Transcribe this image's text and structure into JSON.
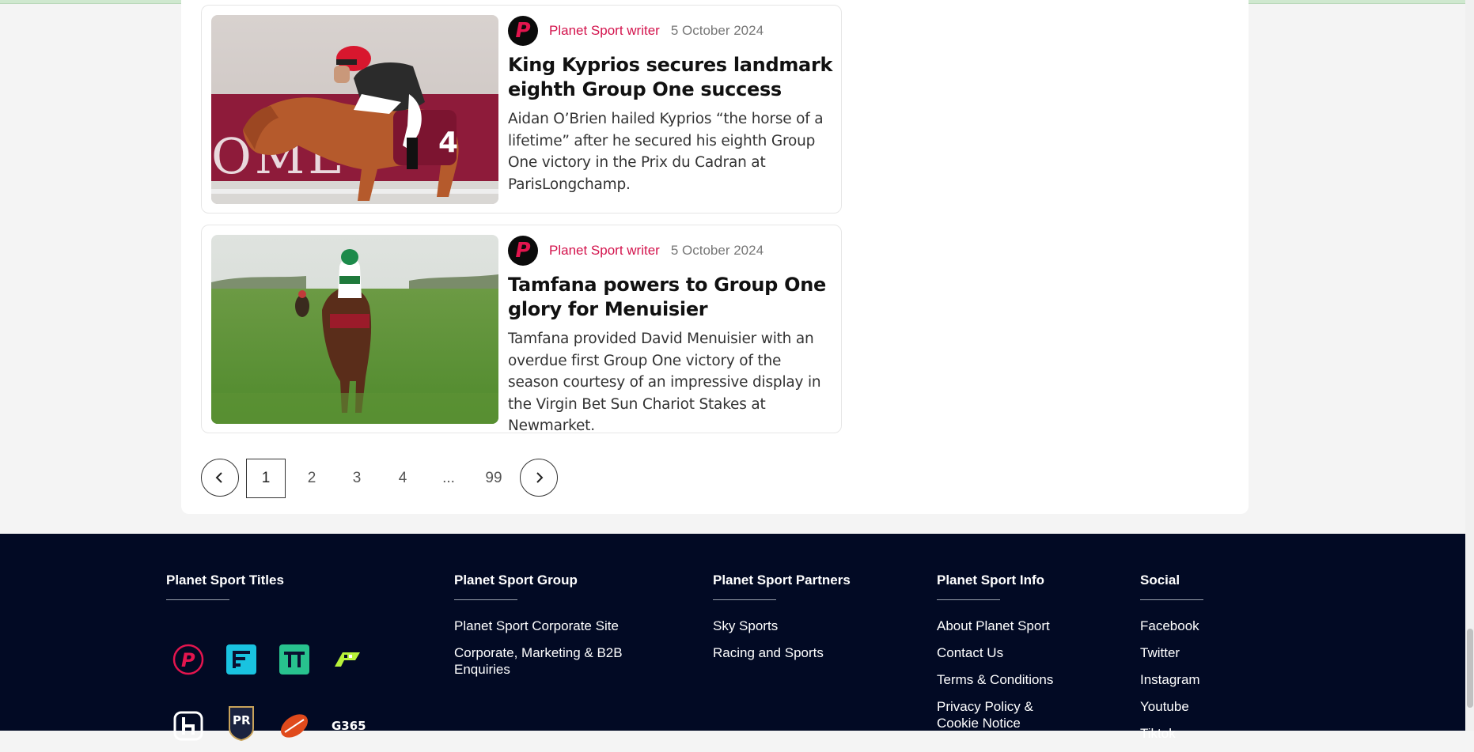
{
  "articles": [
    {
      "author": "Planet Sport writer",
      "date": "5 October 2024",
      "title": "King Kyprios secures landmark eighth Group One success",
      "summary": "Aidan O’Brien hailed Kyprios “the horse of a lifetime” after he secured his eighth Group One victory in the Prix du Cadran at ParisLongchamp.",
      "image_icon": "horse-racing-photo",
      "saddle_number": "4",
      "board_text": "OME"
    },
    {
      "author": "Planet Sport writer",
      "date": "5 October 2024",
      "title": "Tamfana powers to Group One glory for Menuisier",
      "summary": "Tamfana provided David Menuisier with an overdue first Group One victory of the season courtesy of an impressive display in the Virgin Bet Sun Chariot Stakes at Newmarket.",
      "image_icon": "horse-racing-photo"
    }
  ],
  "logo_letter": "P",
  "pagination": {
    "pages": [
      "1",
      "2",
      "3",
      "4",
      "...",
      "99"
    ],
    "current": "1"
  },
  "footer": {
    "titles_heading": "Planet Sport Titles",
    "brand_icons": [
      "planet-sport-icon",
      "football365-icon",
      "tennis365-icon",
      "planetf1-icon",
      "loverugbyleague-icon",
      "planet-rugby-icon",
      "rugby-ball-icon",
      "golf365-icon"
    ],
    "golf_label": "G365",
    "pr_label": "PR",
    "group": {
      "heading": "Planet Sport Group",
      "links": [
        "Planet Sport Corporate Site",
        "Corporate, Marketing & B2B Enquiries"
      ]
    },
    "partners": {
      "heading": "Planet Sport Partners",
      "links": [
        "Sky Sports",
        "Racing and Sports"
      ]
    },
    "info": {
      "heading": "Planet Sport Info",
      "links": [
        "About Planet Sport",
        "Contact Us",
        "Terms & Conditions",
        "Privacy Policy & Cookie Notice"
      ]
    },
    "social": {
      "heading": "Social",
      "links": [
        "Facebook",
        "Twitter",
        "Instagram",
        "Youtube",
        "Tiktok"
      ]
    }
  },
  "colors": {
    "accent": "#d3134c",
    "footer_bg": "#020a24"
  }
}
